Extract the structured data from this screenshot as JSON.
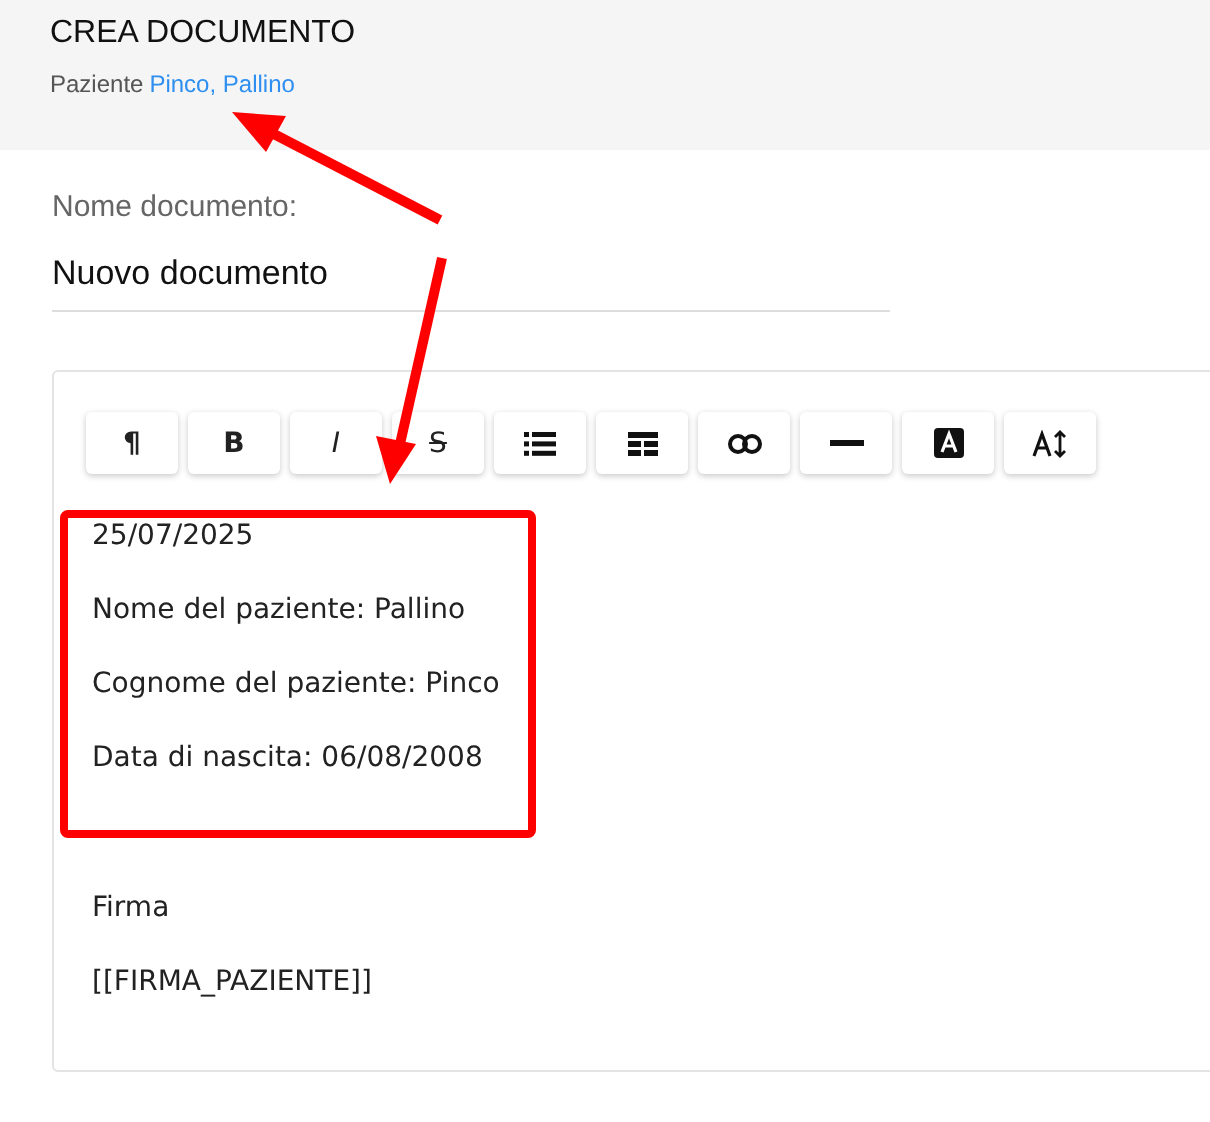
{
  "header": {
    "title": "CREA DOCUMENTO",
    "patient_label": "Paziente",
    "patient_name": "Pinco, Pallino"
  },
  "document_name": {
    "label": "Nome documento:",
    "value": "Nuovo documento"
  },
  "toolbar": [
    {
      "kind": "paragraph",
      "label": "¶"
    },
    {
      "kind": "bold",
      "label": "B"
    },
    {
      "kind": "italic",
      "label": "I"
    },
    {
      "kind": "strike",
      "label": "S"
    },
    {
      "kind": "list"
    },
    {
      "kind": "table"
    },
    {
      "kind": "link"
    },
    {
      "kind": "rule"
    },
    {
      "kind": "color"
    },
    {
      "kind": "size"
    }
  ],
  "editor_sections": [
    [
      "25/07/2025",
      "Nome del paziente: Pallino",
      "Cognome del paziente: Pinco",
      "Data di nascita: 06/08/2008"
    ],
    [
      "Firma",
      "[[FIRMA_PAZIENTE]]"
    ]
  ]
}
